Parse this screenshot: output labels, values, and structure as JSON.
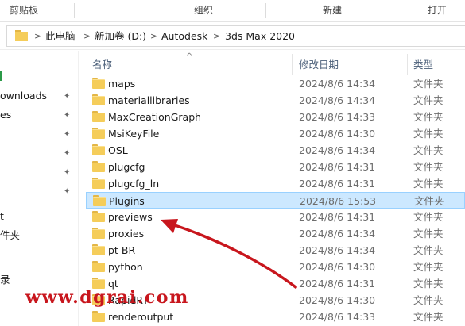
{
  "ribbon": {
    "groups": [
      "剪贴板",
      "组织",
      "新建",
      "打开"
    ]
  },
  "address": {
    "crumbs": [
      "此电脑",
      "新加卷 (D:)",
      "Autodesk",
      "3ds Max 2020"
    ],
    "separator": ">"
  },
  "nav": {
    "items": [
      "ownloads",
      "es",
      "",
      "",
      "",
      "",
      "t",
      "件夹",
      "",
      "录"
    ]
  },
  "columns": {
    "name": "名称",
    "date": "修改日期",
    "type": "类型"
  },
  "files": [
    {
      "name": "maps",
      "date": "2024/8/6 14:34",
      "type": "文件夹"
    },
    {
      "name": "materiallibraries",
      "date": "2024/8/6 14:34",
      "type": "文件夹"
    },
    {
      "name": "MaxCreationGraph",
      "date": "2024/8/6 14:33",
      "type": "文件夹"
    },
    {
      "name": "MsiKeyFile",
      "date": "2024/8/6 14:30",
      "type": "文件夹"
    },
    {
      "name": "OSL",
      "date": "2024/8/6 14:34",
      "type": "文件夹"
    },
    {
      "name": "plugcfg",
      "date": "2024/8/6 14:31",
      "type": "文件夹"
    },
    {
      "name": "plugcfg_ln",
      "date": "2024/8/6 14:31",
      "type": "文件夹"
    },
    {
      "name": "Plugins",
      "date": "2024/8/6 15:53",
      "type": "文件夹",
      "selected": true
    },
    {
      "name": "previews",
      "date": "2024/8/6 14:31",
      "type": "文件夹"
    },
    {
      "name": "proxies",
      "date": "2024/8/6 14:34",
      "type": "文件夹"
    },
    {
      "name": "pt-BR",
      "date": "2024/8/6 14:34",
      "type": "文件夹"
    },
    {
      "name": "python",
      "date": "2024/8/6 14:30",
      "type": "文件夹"
    },
    {
      "name": "qt",
      "date": "2024/8/6 14:31",
      "type": "文件夹"
    },
    {
      "name": "RapidRT",
      "date": "2024/8/6 14:30",
      "type": "文件夹"
    },
    {
      "name": "renderoutput",
      "date": "2024/8/6 14:33",
      "type": "文件夹"
    }
  ],
  "watermark": "www.dgrai.com",
  "colors": {
    "selection": "#cce8ff",
    "folder": "#f5cd5a",
    "annotation": "#c8161d"
  }
}
